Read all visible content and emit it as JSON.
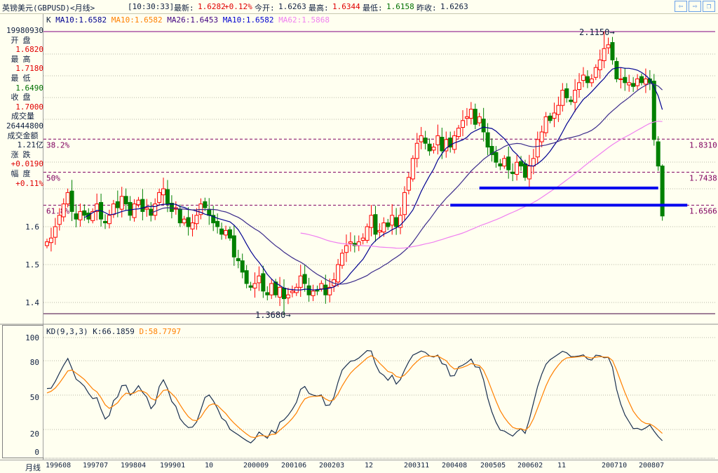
{
  "header": {
    "title": "英镑美元(GBPUSD)<月线>",
    "time": "[10:30:33]",
    "latest_label": "最新:",
    "latest": "1.6282",
    "change_pct": "+0.12%",
    "open_label": "今开:",
    "open": "1.6263",
    "high_label": "最高:",
    "high": "1.6344",
    "low_label": "最低:",
    "low": "1.6158",
    "prev_label": "昨收:",
    "prev": "1.6263"
  },
  "nav": {
    "back": "⇦",
    "forward": "⇨",
    "restore": "❐"
  },
  "info": {
    "date": "19980930",
    "open_label": "开盘",
    "open": "1.6820",
    "high_label": "最高",
    "high": "1.7180",
    "low_label": "最低",
    "low": "1.6490",
    "close_label": "收盘",
    "close": "1.7000",
    "vol_label": "成交量",
    "vol": "26444800",
    "amount_label": "成交金额",
    "amount": "1.21亿",
    "change_label": "涨跌",
    "change": "+0.0190",
    "range_label": "幅度",
    "range": "+0.11%"
  },
  "legend": {
    "k": "K",
    "ma1": "MA10:1.6582",
    "ma2": "MA10:1.6582",
    "ma3": "MA26:1.6453",
    "ma4": "MA10:1.6582",
    "ma5": "MA62:1.5868"
  },
  "kd_legend": {
    "name": "KD(9,3,3)",
    "k": "K:66.1859",
    "d": "D:58.7797"
  },
  "colors": {
    "up": "#ff0000",
    "down": "#008000",
    "ma10": "#000090",
    "ma26": "#3a2a8a",
    "ma62": "#f080f0",
    "k": "#1a3050",
    "d": "#ff8000",
    "drawn": "#0000ee",
    "fib": "#800060"
  },
  "price_axis": {
    "ticks": [
      "1.6",
      "1.5",
      "1.4"
    ],
    "max_label": "2.1150",
    "min_label": "1.3680"
  },
  "fib_levels": [
    {
      "pct": "38.2%",
      "value": "1.8310",
      "price": 1.831
    },
    {
      "pct": "50%",
      "value": "1.7438",
      "price": 1.7438
    },
    {
      "pct": "61.8%",
      "value": "1.6566",
      "price": 1.6566
    }
  ],
  "drawn_lines": [
    {
      "price": 1.702,
      "from": 104,
      "to": 147
    },
    {
      "price": 1.6566,
      "from": 97,
      "to": 154
    }
  ],
  "kd_axis": {
    "ticks": [
      "100",
      "80",
      "50",
      "20",
      "0"
    ]
  },
  "xaxis": {
    "period_label": "月线",
    "labels": [
      "199608",
      "199707",
      "199804",
      "199901",
      "10",
      "200009",
      "200106",
      "200203",
      "12",
      "200311",
      "200408",
      "200505",
      "200602",
      "11",
      "200710",
      "200807"
    ]
  },
  "chart_data": {
    "type": "candlestick",
    "start": "199608",
    "closes": [
      1.56,
      1.57,
      1.6,
      1.63,
      1.66,
      1.69,
      1.64,
      1.62,
      1.64,
      1.63,
      1.62,
      1.64,
      1.66,
      1.62,
      1.61,
      1.63,
      1.66,
      1.65,
      1.68,
      1.66,
      1.63,
      1.66,
      1.67,
      1.64,
      1.65,
      1.63,
      1.66,
      1.69,
      1.7,
      1.66,
      1.64,
      1.65,
      1.61,
      1.62,
      1.6,
      1.61,
      1.63,
      1.66,
      1.65,
      1.63,
      1.61,
      1.6,
      1.58,
      1.59,
      1.57,
      1.52,
      1.51,
      1.48,
      1.45,
      1.44,
      1.45,
      1.47,
      1.43,
      1.42,
      1.45,
      1.42,
      1.44,
      1.41,
      1.42,
      1.43,
      1.44,
      1.47,
      1.45,
      1.42,
      1.43,
      1.43,
      1.45,
      1.42,
      1.44,
      1.46,
      1.5,
      1.53,
      1.55,
      1.56,
      1.55,
      1.56,
      1.57,
      1.6,
      1.63,
      1.58,
      1.59,
      1.61,
      1.6,
      1.63,
      1.6,
      1.63,
      1.69,
      1.73,
      1.78,
      1.82,
      1.84,
      1.82,
      1.8,
      1.81,
      1.84,
      1.8,
      1.83,
      1.81,
      1.84,
      1.86,
      1.88,
      1.89,
      1.91,
      1.87,
      1.89,
      1.85,
      1.81,
      1.79,
      1.77,
      1.76,
      1.78,
      1.75,
      1.74,
      1.77,
      1.76,
      1.73,
      1.76,
      1.78,
      1.83,
      1.85,
      1.89,
      1.88,
      1.9,
      1.92,
      1.96,
      1.94,
      1.93,
      1.96,
      1.98,
      2.0,
      1.98,
      1.99,
      2.02,
      2.04,
      2.07,
      2.08,
      2.04,
      1.99,
      1.99,
      1.98,
      1.98,
      1.97,
      1.99,
      1.98,
      1.99,
      1.98,
      1.83,
      1.76,
      1.6282
    ],
    "ylim": [
      1.37,
      2.115
    ],
    "kd_ylim": [
      0,
      100
    ]
  }
}
